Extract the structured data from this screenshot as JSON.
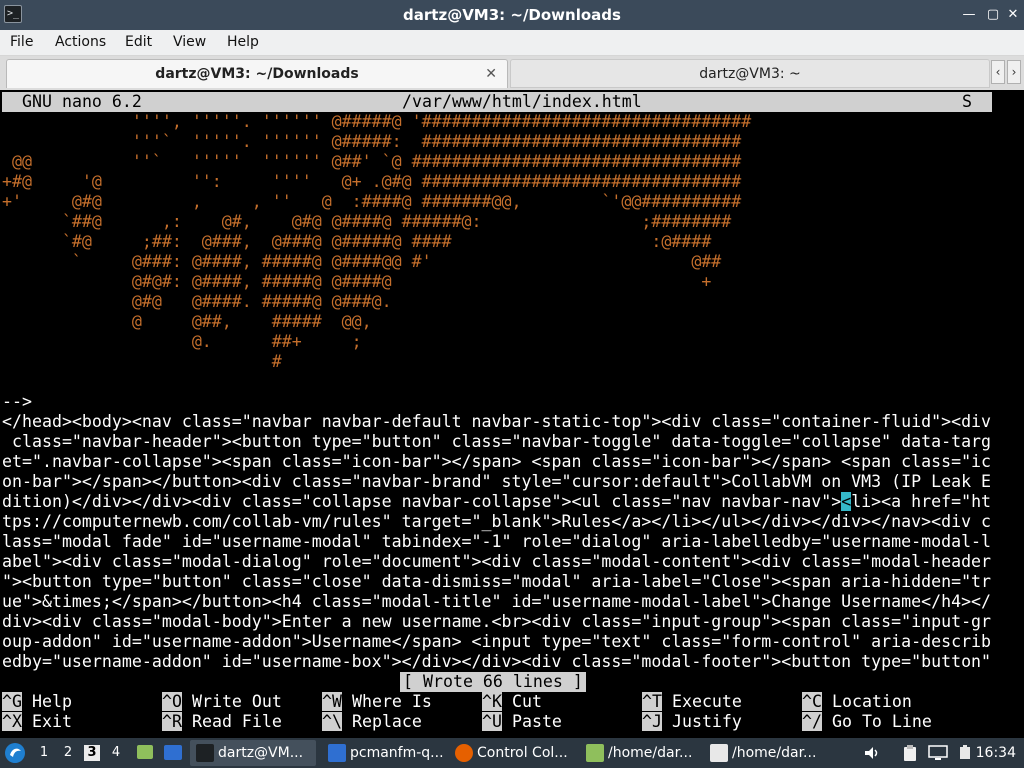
{
  "window": {
    "title": "dartz@VM3: ~/Downloads",
    "icon": "terminal-icon"
  },
  "menu": [
    "File",
    "Actions",
    "Edit",
    "View",
    "Help"
  ],
  "tabs": [
    {
      "label": "dartz@VM3: ~/Downloads",
      "active": true
    },
    {
      "label": "dartz@VM3: ~",
      "active": false
    }
  ],
  "nano": {
    "version": "GNU nano 6.2",
    "filename": "/var/www/html/index.html",
    "flag": "S",
    "status_message": "[ Wrote 66 lines ]",
    "ascii_art": [
      "             '''', '''''. '''''' @#####@ '#################################",
      "             '''`  '''''. '''''' @#####:  ################################",
      " @@          ''`   '''''  '''''' @##' `@ #################################",
      "+#@     '@         '':     ''''   @+ .@#@ ################################",
      "+'     @#@         ,     , ''   @  :####@ #######@@,        `'@@##########",
      "      `##@      ,:    @#,    @#@ @####@ ######@:                ;########",
      "      `#@     ;##:  @###,  @###@ @#####@ ####                    :@####",
      "       `     @###: @####, #####@ @####@@ #'                          @##",
      "             @#@#: @####, #####@ @####@                               +",
      "             @#@   @####. #####@ @###@.",
      "             @     @##,    #####  @@,",
      "                   @.      ##+     ;",
      "                           #"
    ],
    "code_lines": [
      "-->",
      "</head><body><nav class=\"navbar navbar-default navbar-static-top\"><div class=\"container-fluid\"><div",
      " class=\"navbar-header\"><button type=\"button\" class=\"navbar-toggle\" data-toggle=\"collapse\" data-targ",
      "et=\".navbar-collapse\"><span class=\"icon-bar\"></span> <span class=\"icon-bar\"></span> <span class=\"ic",
      "on-bar\"></span></button><div class=\"navbar-brand\" style=\"cursor:default\">CollabVM on VM3 (IP Leak E",
      "dition)</div></div><div class=\"collapse navbar-collapse\"><ul class=\"nav navbar-nav\">",
      "tps://computernewb.com/collab-vm/rules\" target=\"_blank\">Rules</a></li></ul></div></div></nav><div c",
      "lass=\"modal fade\" id=\"username-modal\" tabindex=\"-1\" role=\"dialog\" aria-labelledby=\"username-modal-l",
      "abel\"><div class=\"modal-dialog\" role=\"document\"><div class=\"modal-content\"><div class=\"modal-header",
      "\"><button type=\"button\" class=\"close\" data-dismiss=\"modal\" aria-label=\"Close\"><span aria-hidden=\"tr",
      "ue\">&times;</span></button><h4 class=\"modal-title\" id=\"username-modal-label\">Change Username</h4></",
      "div><div class=\"modal-body\">Enter a new username.<br><div class=\"input-group\"><span class=\"input-gr",
      "oup-addon\" id=\"username-addon\">Username</span> <input type=\"text\" class=\"form-control\" aria-describ",
      "edby=\"username-addon\" id=\"username-box\"></div></div><div class=\"modal-footer\"><button type=\"button\""
    ],
    "cursor_line_tail": "<li><a href=\"ht",
    "shortcuts": [
      {
        "key": "^G",
        "label": "Help"
      },
      {
        "key": "^O",
        "label": "Write Out"
      },
      {
        "key": "^W",
        "label": "Where Is"
      },
      {
        "key": "^K",
        "label": "Cut"
      },
      {
        "key": "^T",
        "label": "Execute"
      },
      {
        "key": "^C",
        "label": "Location"
      },
      {
        "key": "^X",
        "label": "Exit"
      },
      {
        "key": "^R",
        "label": "Read File"
      },
      {
        "key": "^\\",
        "label": "Replace"
      },
      {
        "key": "^U",
        "label": "Paste"
      },
      {
        "key": "^J",
        "label": "Justify"
      },
      {
        "key": "^/",
        "label": "Go To Line"
      }
    ]
  },
  "taskbar": {
    "workspaces": [
      "1",
      "2",
      "3",
      "4"
    ],
    "active_workspace": "3",
    "tasks": [
      {
        "label": "dartz@VM...",
        "icon": "terminal-icon",
        "active": true
      },
      {
        "label": "pcmanfm-q...",
        "icon": "folder-icon",
        "active": false
      },
      {
        "label": "Control Col...",
        "icon": "firefox-icon",
        "active": false
      },
      {
        "label": "/home/dar...",
        "icon": "file-archive-icon",
        "active": false
      },
      {
        "label": "/home/dar...",
        "icon": "text-editor-icon",
        "active": false
      }
    ],
    "clock": "16:34"
  },
  "colors": {
    "titlebar": "#3b4a5a",
    "taskbar": "#2b3640",
    "ascii_art": "#c56f2c",
    "cursor": "#35b8c8"
  }
}
